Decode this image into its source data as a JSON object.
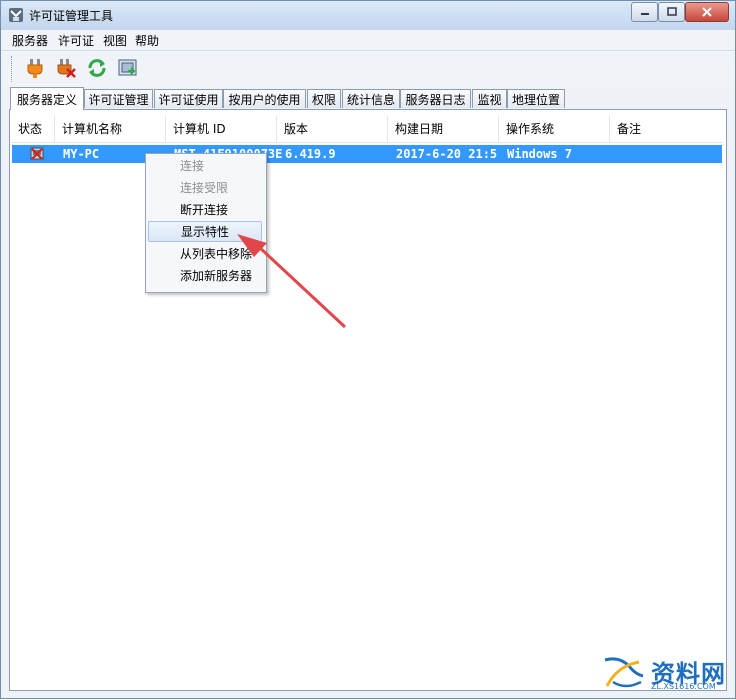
{
  "window": {
    "title": "许可证管理工具",
    "min_label": "─",
    "max_label": "□",
    "close_label": "✕"
  },
  "menu": [
    "服务器",
    "许可证",
    "视图",
    "帮助"
  ],
  "toolbar": {
    "icons": [
      "plug-connect-icon",
      "plug-disconnect-icon",
      "refresh-icon",
      "server-properties-icon"
    ]
  },
  "tabs": [
    "服务器定义",
    "许可证管理",
    "许可证使用",
    "按用户的使用",
    "权限",
    "统计信息",
    "服务器日志",
    "监视",
    "地理位置"
  ],
  "table": {
    "columns": [
      "状态",
      "计算机名称",
      "计算机 ID",
      "版本",
      "构建日期",
      "操作系统",
      "备注"
    ],
    "rows": [
      {
        "status_icon": "server-disconnected-icon",
        "name": "MY-PC",
        "id": "MST-41E9100073E",
        "version": "6.419.9",
        "date": "2017-6-20 21:5",
        "os": "Windows 7",
        "note": ""
      }
    ]
  },
  "context_menu": {
    "items": [
      {
        "label": "连接",
        "enabled": false
      },
      {
        "label": "连接受限",
        "enabled": false
      },
      {
        "label": "断开连接",
        "enabled": true
      },
      {
        "label": "显示特性",
        "enabled": true,
        "highlighted": true
      },
      {
        "label": "从列表中移除",
        "enabled": true
      },
      {
        "label": "添加新服务器",
        "enabled": true
      }
    ]
  },
  "annotation": {
    "arrow_color": "#e0464a"
  },
  "watermark": {
    "name": "资料网",
    "url": "ZL.XS1616.COM"
  },
  "colors": {
    "selection": "#3399ff",
    "tab_border": "#8d9db1"
  }
}
